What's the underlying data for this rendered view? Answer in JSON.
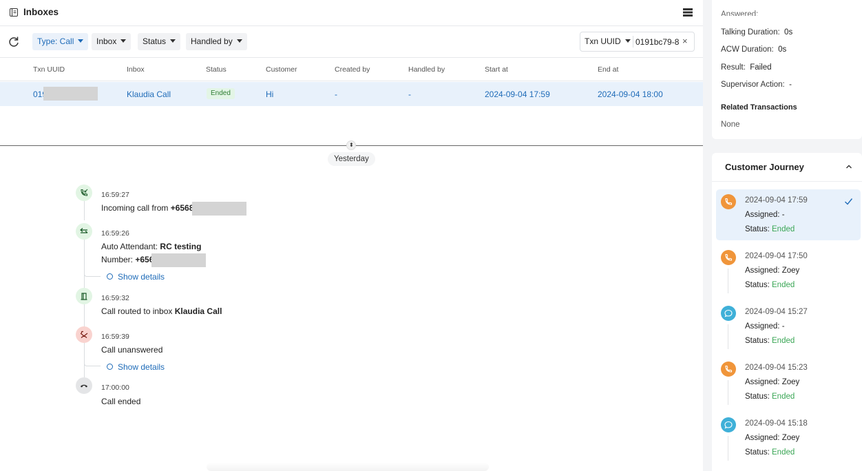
{
  "header": {
    "title": "Inboxes"
  },
  "filters": {
    "type_label": "Type: Call",
    "inbox_label": "Inbox",
    "status_label": "Status",
    "handled_by_label": "Handled by"
  },
  "search": {
    "field": "Txn UUID",
    "value": "0191bc79-8",
    "clear_glyph": "×"
  },
  "table": {
    "columns": [
      "Txn UUID",
      "Inbox",
      "Status",
      "Customer",
      "Created by",
      "Handled by",
      "Start at",
      "End at"
    ],
    "row": {
      "txn_uuid": "019",
      "inbox": "Klaudia Call",
      "status": "Ended",
      "customer": "Hi",
      "created_by": "-",
      "handled_by": "-",
      "start_at": "2024-09-04 17:59",
      "end_at": "2024-09-04 18:00"
    }
  },
  "timeline": {
    "date_label": "Yesterday",
    "events": [
      {
        "time": "16:59:27",
        "prefix": "Incoming call from ",
        "bold": "+6568",
        "icon": "incoming-call-icon"
      },
      {
        "time": "16:59:26",
        "prefix": "Auto Attendant: ",
        "bold": "RC testing",
        "line2_prefix": "Number: ",
        "line2_bold": "+656",
        "details": "Show details",
        "icon": "transfer-icon"
      },
      {
        "time": "16:59:32",
        "prefix": "Call routed to inbox ",
        "bold": "Klaudia Call",
        "icon": "inbox-route-icon"
      },
      {
        "time": "16:59:39",
        "prefix": "Call unanswered",
        "details": "Show details",
        "icon": "missed-call-icon"
      },
      {
        "time": "17:00:00",
        "prefix": "Call ended",
        "icon": "hang-up-icon"
      }
    ]
  },
  "details_panel": {
    "partial_top": "Answered:",
    "talking_duration_label": "Talking Duration:",
    "talking_duration": "0s",
    "acw_duration_label": "ACW Duration:",
    "acw_duration": "0s",
    "result_label": "Result:",
    "result": "Failed",
    "supervisor_label": "Supervisor Action:",
    "supervisor": "-",
    "related_title": "Related Transactions",
    "related_value": "None"
  },
  "journey": {
    "title": "Customer Journey",
    "assigned_label": "Assigned:",
    "status_label": "Status:",
    "items": [
      {
        "datetime": "2024-09-04 17:59",
        "assigned": "-",
        "status": "Ended",
        "channel": "call",
        "selected": true
      },
      {
        "datetime": "2024-09-04 17:50",
        "assigned": "Zoey",
        "status": "Ended",
        "channel": "call"
      },
      {
        "datetime": "2024-09-04 15:27",
        "assigned": "-",
        "status": "Ended",
        "channel": "chat"
      },
      {
        "datetime": "2024-09-04 15:23",
        "assigned": "Zoey",
        "status": "Ended",
        "channel": "call"
      },
      {
        "datetime": "2024-09-04 15:18",
        "assigned": "Zoey",
        "status": "Ended",
        "channel": "chat"
      }
    ]
  },
  "colors": {
    "accent": "#1e6bb8",
    "status_ended": "#3aa655",
    "call_icon": "#f0953a",
    "chat_icon": "#3fb0d8",
    "selected_row": "#e8f1fb"
  }
}
